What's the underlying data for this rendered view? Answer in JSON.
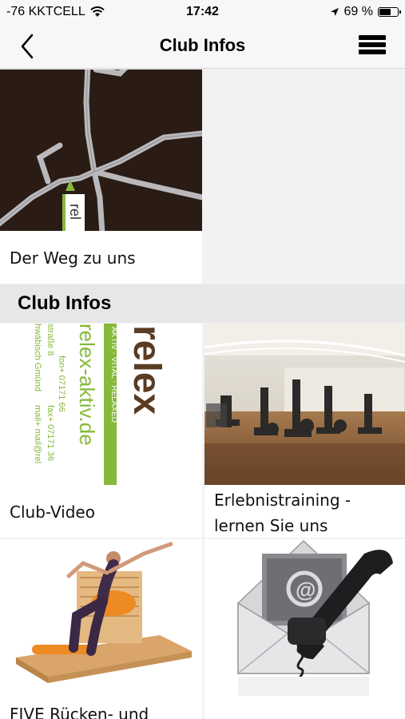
{
  "status": {
    "carrier": "-76 KKTCELL",
    "time": "17:42",
    "battery": "69 %",
    "battery_level": 0.69
  },
  "nav": {
    "title": "Club Infos"
  },
  "top_tile": {
    "label": "Der Weg zu uns"
  },
  "section": {
    "title": "Club Infos"
  },
  "tiles": [
    {
      "label": "Club-Video"
    },
    {
      "label": "Erlebnistraining - lernen Sie uns kennen!"
    },
    {
      "label": "FIVE Rücken- und"
    },
    {
      "label": ""
    }
  ],
  "map_image": {
    "logo_text": "rel"
  },
  "video_image": {
    "logo_text": "relex",
    "stripe_text": "AKTIV · VITAL · RELAXED",
    "url_text": "relex-aktiv.de",
    "addr_lines": [
      "straße 8",
      "hwäbisch Gmünd",
      "fon+ 07171 66",
      "fax+ 07171 36",
      "mail+ mail@rel"
    ]
  },
  "colors": {
    "map_bg": "#2a1c14",
    "brand_green": "#86b93a"
  }
}
